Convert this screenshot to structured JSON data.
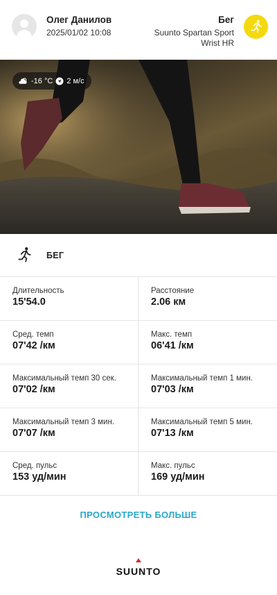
{
  "header": {
    "user_name": "Олег Данилов",
    "date": "2025/01/02 10:08",
    "activity": "Бег",
    "device": "Suunto Spartan Sport Wrist HR",
    "activity_icon_color": "#f5d90f",
    "activity_icon": "running-person-icon"
  },
  "weather": {
    "temperature": "-16 °C",
    "wind": "2 м/с",
    "weather_icon": "cloud-sun-icon",
    "wind_icon": "navigation-arrow-icon"
  },
  "section": {
    "label": "БЕГ",
    "icon": "running-person-icon"
  },
  "stats": [
    {
      "left": {
        "label": "Длительность",
        "value": "15'54.0"
      },
      "right": {
        "label": "Расстояние",
        "value": "2.06 км"
      }
    },
    {
      "left": {
        "label": "Сред. темп",
        "value": "07'42 /км"
      },
      "right": {
        "label": "Макс. темп",
        "value": "06'41 /км"
      }
    },
    {
      "left": {
        "label": "Максимальный темп 30 сек.",
        "value": "07'02 /км"
      },
      "right": {
        "label": "Максимальный темп 1 мин.",
        "value": "07'03 /км"
      }
    },
    {
      "left": {
        "label": "Максимальный темп 3 мин.",
        "value": "07'07 /км"
      },
      "right": {
        "label": "Максимальный темп 5 мин.",
        "value": "07'13 /км"
      }
    },
    {
      "left": {
        "label": "Сред. пульс",
        "value": "153 уд/мин"
      },
      "right": {
        "label": "Макс. пульс",
        "value": "169 уд/мин"
      }
    }
  ],
  "more_button": "ПРОСМОТРЕТЬ БОЛЬШЕ",
  "brand": "SUUNTO",
  "colors": {
    "accent": "#2aa7c9",
    "brand_triangle": "#e0282a"
  }
}
